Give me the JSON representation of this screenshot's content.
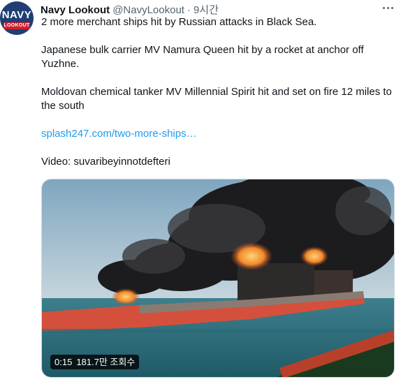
{
  "tweet": {
    "avatar": {
      "line1": "NAVY",
      "line2": "LOOKOUT"
    },
    "author_name": "Navy Lookout",
    "handle": "@NavyLookout",
    "separator": "·",
    "time": "9시간",
    "paragraphs": [
      "2 more merchant ships hit by Russian attacks in Black Sea.",
      "Japanese bulk carrier MV Namura Queen hit by a rocket at anchor off Yuzhne.",
      "Moldovan chemical tanker MV Millennial Spirit hit and set on fire 12 miles to the south"
    ],
    "link_text": "splash247.com/two-more-ships…",
    "video_credit": "Video: suvaribeyinnotdefteri",
    "video": {
      "duration": "0:15",
      "views": "181.7만 조회수"
    }
  },
  "icons": {
    "more": "more-horizontal-icon"
  },
  "colors": {
    "link": "#1d9bf0",
    "secondary_text": "#536471",
    "hull_red": "#d5503c"
  }
}
